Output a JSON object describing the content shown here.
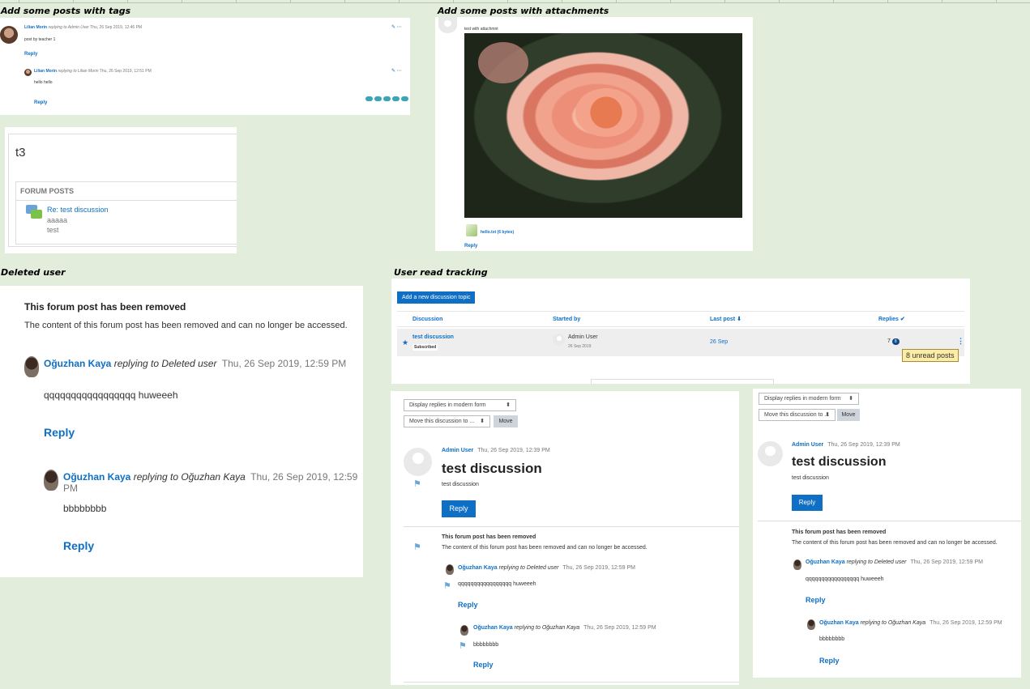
{
  "captions": {
    "tags": "Add some posts with tags",
    "attachments": "Add some posts with attachments",
    "deleted": "Deleted user",
    "tracking": "User read tracking"
  },
  "tags_panel": {
    "post1": {
      "author": "Lilian Morin",
      "replying": "replying to Admin User",
      "date": "Thu, 26 Sep 2019, 12:46 PM",
      "body": "post by teacher 1",
      "reply": "Reply"
    },
    "post2": {
      "author": "Lilian Morin",
      "replying": "replying to Lilian Morin",
      "date": "Thu, 26 Sep 2019, 12:51 PM",
      "body": "hello hello",
      "reply": "Reply"
    }
  },
  "t3_panel": {
    "title": "t3",
    "section": "FORUM POSTS",
    "link": "Re: test discussion",
    "line1": "aaaaa",
    "line2": "test"
  },
  "attach_panel": {
    "body": "test with attachmnt",
    "file": "hello.txt (6 bytes)",
    "reply": "Reply"
  },
  "deleted_panel": {
    "removed_title": "This forum post has been removed",
    "removed_body": "The content of this forum post has been removed and can no longer be accessed.",
    "post1": {
      "author": "Oğuzhan Kaya",
      "replying": "replying to Deleted user",
      "date": "Thu, 26 Sep 2019, 12:59 PM",
      "body": "qqqqqqqqqqqqqqqqq huweeeh",
      "reply": "Reply"
    },
    "post2": {
      "author": "Oğuzhan Kaya",
      "replying": "replying to Oğuzhan Kaya",
      "date": "Thu, 26 Sep 2019, 12:59 PM",
      "body": "bbbbbbbb",
      "reply": "Reply"
    }
  },
  "tracking_panel": {
    "add_button": "Add a new discussion topic",
    "columns": {
      "discussion": "Discussion",
      "started_by": "Started by",
      "last_post": "Last post",
      "replies": "Replies"
    },
    "row": {
      "title": "test discussion",
      "badge": "Subscribed",
      "starter": "Admin User",
      "started_date": "26 Sep 2019",
      "last_post": "26 Sep",
      "replies": "7",
      "unread_count": "8"
    },
    "tooltip": "8 unread posts"
  },
  "discussion_views": {
    "display_mode": "Display replies in modern form",
    "move_placeholder": "Move this discussion to ...",
    "move_button": "Move",
    "root": {
      "author": "Admin User",
      "date": "Thu, 26 Sep 2019, 12:39 PM",
      "title": "test discussion",
      "body": "test discussion",
      "reply": "Reply"
    },
    "removed_title": "This forum post has been removed",
    "removed_body": "The content of this forum post has been removed and can no longer be accessed.",
    "post1": {
      "author": "Oğuzhan Kaya",
      "replying": "replying to Deleted user",
      "date": "Thu, 26 Sep 2019, 12:59 PM",
      "body": "qqqqqqqqqqqqqqqqq huweeeh",
      "reply": "Reply"
    },
    "post2": {
      "author": "Oğuzhan Kaya",
      "replying": "replying to Oğuzhan Kaya",
      "date": "Thu, 26 Sep 2019, 12:59 PM",
      "body": "bbbbbbbb",
      "reply": "Reply"
    }
  }
}
